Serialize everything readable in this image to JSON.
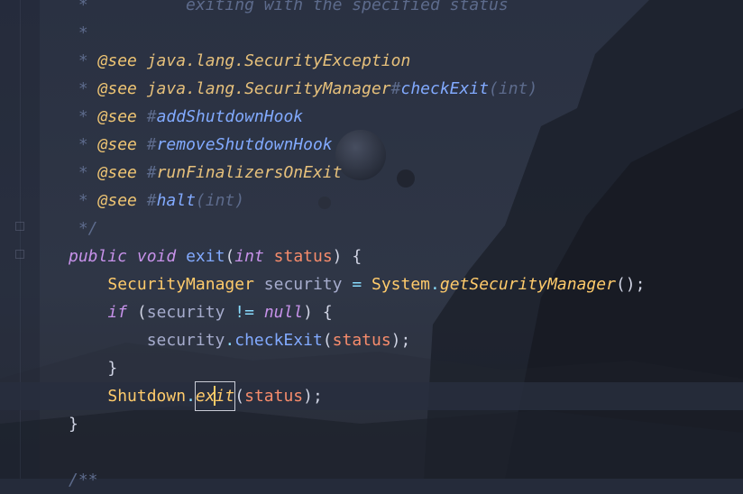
{
  "editor": {
    "lines": [
      {
        "id": "l0",
        "parts": [
          {
            "t": " *          ",
            "c": "comment"
          },
          {
            "t": "exiting with the specified status",
            "c": "comment"
          }
        ]
      },
      {
        "id": "l1",
        "parts": [
          {
            "t": " *",
            "c": "comment"
          }
        ]
      },
      {
        "id": "l2",
        "parts": [
          {
            "t": " * ",
            "c": "comment"
          },
          {
            "t": "@see",
            "c": "tag"
          },
          {
            "t": " ",
            "c": "comment"
          },
          {
            "t": "java.lang.SecurityException",
            "c": "ref"
          }
        ]
      },
      {
        "id": "l3",
        "parts": [
          {
            "t": " * ",
            "c": "comment"
          },
          {
            "t": "@see",
            "c": "tag"
          },
          {
            "t": " ",
            "c": "comment"
          },
          {
            "t": "java.lang.SecurityManager",
            "c": "ref"
          },
          {
            "t": "#",
            "c": "hash"
          },
          {
            "t": "checkExit",
            "c": "link"
          },
          {
            "t": "(int)",
            "c": "comment"
          }
        ]
      },
      {
        "id": "l4",
        "parts": [
          {
            "t": " * ",
            "c": "comment"
          },
          {
            "t": "@see",
            "c": "tag"
          },
          {
            "t": " ",
            "c": "comment"
          },
          {
            "t": "#",
            "c": "hash"
          },
          {
            "t": "addShutdownHook",
            "c": "link"
          }
        ]
      },
      {
        "id": "l5",
        "parts": [
          {
            "t": " * ",
            "c": "comment"
          },
          {
            "t": "@see",
            "c": "tag"
          },
          {
            "t": " ",
            "c": "comment"
          },
          {
            "t": "#",
            "c": "hash"
          },
          {
            "t": "removeShutdownHook",
            "c": "link"
          }
        ]
      },
      {
        "id": "l6",
        "parts": [
          {
            "t": " * ",
            "c": "comment"
          },
          {
            "t": "@see",
            "c": "tag"
          },
          {
            "t": " ",
            "c": "comment"
          },
          {
            "t": "#",
            "c": "hash"
          },
          {
            "t": "runFinalizersOnExit",
            "c": "ref"
          }
        ]
      },
      {
        "id": "l7",
        "parts": [
          {
            "t": " * ",
            "c": "comment"
          },
          {
            "t": "@see",
            "c": "tag"
          },
          {
            "t": " ",
            "c": "comment"
          },
          {
            "t": "#",
            "c": "hash"
          },
          {
            "t": "halt",
            "c": "link"
          },
          {
            "t": "(int)",
            "c": "comment"
          }
        ]
      },
      {
        "id": "l8",
        "parts": [
          {
            "t": " */",
            "c": "comment"
          }
        ]
      },
      {
        "id": "l9",
        "parts": [
          {
            "t": "public",
            "c": "kw"
          },
          {
            "t": " ",
            "c": "plain"
          },
          {
            "t": "void",
            "c": "kw"
          },
          {
            "t": " ",
            "c": "plain"
          },
          {
            "t": "exit",
            "c": "fn"
          },
          {
            "t": "(",
            "c": "plain"
          },
          {
            "t": "int",
            "c": "kw"
          },
          {
            "t": " ",
            "c": "plain"
          },
          {
            "t": "status",
            "c": "param"
          },
          {
            "t": ") {",
            "c": "plain"
          }
        ]
      },
      {
        "id": "l10",
        "parts": [
          {
            "t": "    ",
            "c": "plain"
          },
          {
            "t": "SecurityManager",
            "c": "type"
          },
          {
            "t": " ",
            "c": "plain"
          },
          {
            "t": "security",
            "c": "var"
          },
          {
            "t": " ",
            "c": "plain"
          },
          {
            "t": "=",
            "c": "punc"
          },
          {
            "t": " ",
            "c": "plain"
          },
          {
            "t": "System",
            "c": "type"
          },
          {
            "t": ".",
            "c": "punc"
          },
          {
            "t": "getSecurityManager",
            "c": "static-call"
          },
          {
            "t": "();",
            "c": "plain"
          }
        ]
      },
      {
        "id": "l11",
        "parts": [
          {
            "t": "    ",
            "c": "plain"
          },
          {
            "t": "if",
            "c": "kw"
          },
          {
            "t": " (",
            "c": "plain"
          },
          {
            "t": "security",
            "c": "var"
          },
          {
            "t": " ",
            "c": "plain"
          },
          {
            "t": "!=",
            "c": "punc"
          },
          {
            "t": " ",
            "c": "plain"
          },
          {
            "t": "null",
            "c": "kw"
          },
          {
            "t": ") {",
            "c": "plain"
          }
        ]
      },
      {
        "id": "l12",
        "parts": [
          {
            "t": "        ",
            "c": "plain"
          },
          {
            "t": "security",
            "c": "var"
          },
          {
            "t": ".",
            "c": "punc"
          },
          {
            "t": "checkExit",
            "c": "call"
          },
          {
            "t": "(",
            "c": "plain"
          },
          {
            "t": "status",
            "c": "param"
          },
          {
            "t": ");",
            "c": "plain"
          }
        ]
      },
      {
        "id": "l13",
        "parts": [
          {
            "t": "    }",
            "c": "plain"
          }
        ]
      },
      {
        "id": "l14",
        "current": true,
        "parts": [
          {
            "t": "    ",
            "c": "plain"
          },
          {
            "t": "Shutdown",
            "c": "type"
          },
          {
            "t": ".",
            "c": "punc"
          },
          {
            "t": "exit",
            "c": "static-call",
            "boxed": true
          },
          {
            "t": "(",
            "c": "plain"
          },
          {
            "t": "status",
            "c": "param"
          },
          {
            "t": ");",
            "c": "plain"
          }
        ]
      },
      {
        "id": "l15",
        "parts": [
          {
            "t": "}",
            "c": "plain"
          }
        ]
      },
      {
        "id": "l16",
        "parts": [
          {
            "t": "",
            "c": "plain"
          }
        ]
      },
      {
        "id": "l17",
        "parts": [
          {
            "t": "/**",
            "c": "comment"
          }
        ]
      }
    ]
  },
  "colors": {
    "background": "#252b3a",
    "keyword": "#c792ea",
    "type": "#ffcb6b",
    "function": "#82aaff",
    "parameter": "#f78c6c",
    "comment": "#5d6b8c",
    "caret": "#ffcc66"
  }
}
